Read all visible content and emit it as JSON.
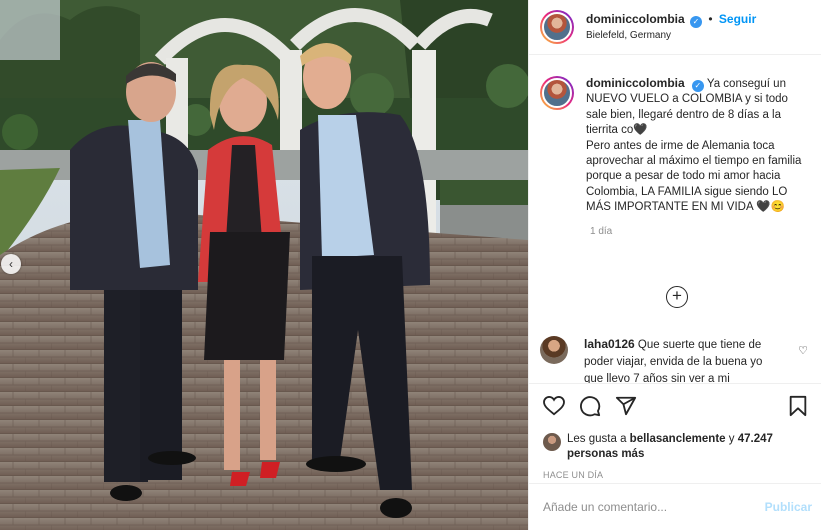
{
  "post": {
    "username": "dominiccolombia",
    "follow_label": "Seguir",
    "location": "Bielefeld, Germany",
    "caption_lines": [
      "Ya conseguí un NUEVO VUELO a COLOMBIA y si todo sale bien, llegaré dentro de 8 días a la tierrita co🖤",
      "Pero antes de irme de Alemania toca aprovechar al máximo el tiempo en familia porque a pesar de todo mi amor hacia Colombia, LA FAMILIA sigue siendo LO MÁS IMPORTANTE EN MI VIDA 🖤😊"
    ],
    "time_ago": "1 día",
    "more_icon": "plus-circle-icon"
  },
  "comment": {
    "username": "laha0126",
    "text": "Que suerte que tiene de poder viajar, envida de la buena yo que llevo 7 años sin ver a mi"
  },
  "actions": {
    "icons": [
      "heart-icon",
      "comment-icon",
      "share-icon",
      "bookmark-icon"
    ]
  },
  "likes": {
    "prefix": "Les gusta a",
    "user": "bellasanclemente",
    "connector": "y",
    "count": "47.247 personas más"
  },
  "timestamp": "HACE UN DÍA",
  "add_comment": {
    "placeholder": "Añade un comentario...",
    "publish_label": "Publicar"
  },
  "colors": {
    "accent": "#0095f6",
    "verified": "#3897f0",
    "muted": "#8e8e8e",
    "publish_disabled": "#b2dffc"
  }
}
